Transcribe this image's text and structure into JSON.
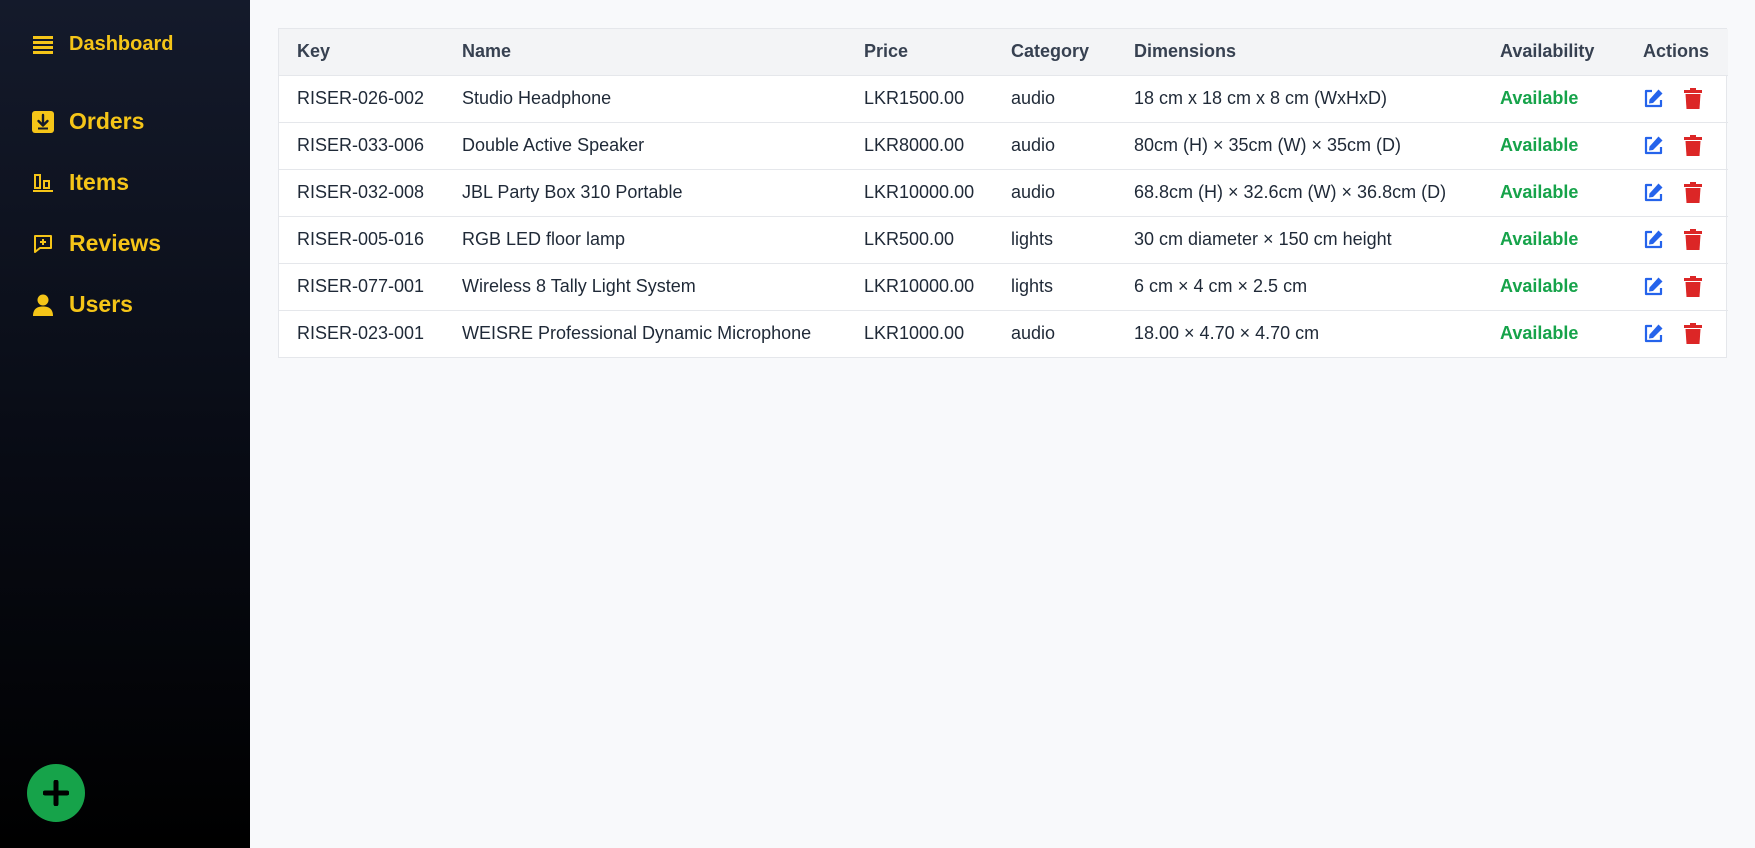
{
  "sidebar": {
    "items": [
      {
        "label": "Dashboard",
        "icon": "list-icon"
      },
      {
        "label": "Orders",
        "icon": "download-box-icon"
      },
      {
        "label": "Items",
        "icon": "bar-chart-icon"
      },
      {
        "label": "Reviews",
        "icon": "message-plus-icon"
      },
      {
        "label": "Users",
        "icon": "user-icon"
      }
    ],
    "add_button_icon": "plus-icon"
  },
  "table": {
    "headers": [
      "Key",
      "Name",
      "Price",
      "Category",
      "Dimensions",
      "Availability",
      "Actions"
    ],
    "rows": [
      {
        "key": "RISER-026-002",
        "name": "Studio Headphone",
        "price": "LKR1500.00",
        "category": "audio",
        "dimensions": "18 cm x 18 cm x 8 cm (WxHxD)",
        "availability": "Available"
      },
      {
        "key": "RISER-033-006",
        "name": "Double Active Speaker",
        "price": "LKR8000.00",
        "category": "audio",
        "dimensions": "80cm (H) × 35cm (W) × 35cm (D)",
        "availability": "Available"
      },
      {
        "key": "RISER-032-008",
        "name": "JBL Party Box 310 Portable",
        "price": "LKR10000.00",
        "category": "audio",
        "dimensions": "68.8cm (H) × 32.6cm (W) × 36.8cm (D)",
        "availability": "Available"
      },
      {
        "key": "RISER-005-016",
        "name": "RGB LED floor lamp",
        "price": "LKR500.00",
        "category": "lights",
        "dimensions": "30 cm diameter × 150 cm height",
        "availability": "Available"
      },
      {
        "key": "RISER-077-001",
        "name": "Wireless 8 Tally Light System",
        "price": "LKR10000.00",
        "category": "lights",
        "dimensions": "6 cm × 4 cm × 2.5 cm",
        "availability": "Available"
      },
      {
        "key": "RISER-023-001",
        "name": "WEISRE Professional Dynamic Microphone",
        "price": "LKR1000.00",
        "category": "audio",
        "dimensions": "18.00 × 4.70 × 4.70 cm",
        "availability": "Available"
      }
    ],
    "row_actions": {
      "edit_icon": "edit-icon",
      "delete_icon": "trash-icon"
    }
  },
  "colors": {
    "accent": "#f5c518",
    "available": "#16a34a",
    "edit": "#2563eb",
    "delete": "#dc2626",
    "fab": "#16a34a"
  }
}
